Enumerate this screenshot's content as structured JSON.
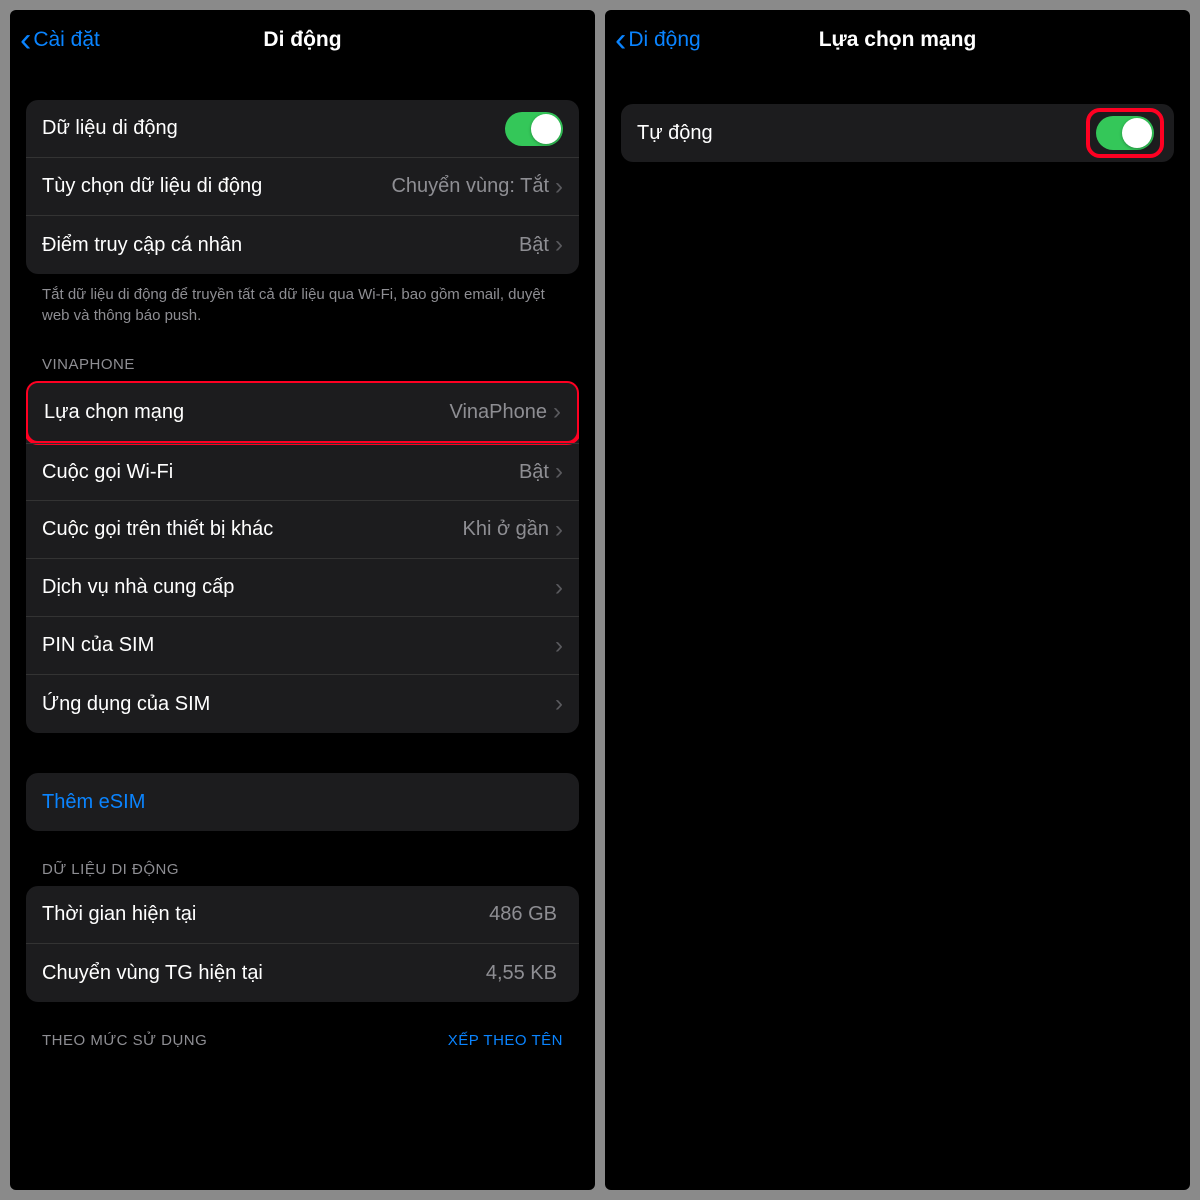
{
  "left": {
    "back": "Cài đặt",
    "title": "Di động",
    "g1": {
      "cellular_data": "Dữ liệu di động",
      "options_label": "Tùy chọn dữ liệu di động",
      "options_value": "Chuyển vùng: Tắt",
      "hotspot_label": "Điểm truy cập cá nhân",
      "hotspot_value": "Bật"
    },
    "footer1": "Tắt dữ liệu di động để truyền tất cả dữ liệu qua Wi-Fi, bao gồm email, duyệt web và thông báo push.",
    "carrier_header": "VINAPHONE",
    "g2": {
      "network_sel_label": "Lựa chọn mạng",
      "network_sel_value": "VinaPhone",
      "wifi_call_label": "Cuộc gọi Wi-Fi",
      "wifi_call_value": "Bật",
      "other_dev_label": "Cuộc gọi trên thiết bị khác",
      "other_dev_value": "Khi ở gần",
      "carrier_svc": "Dịch vụ nhà cung cấp",
      "sim_pin": "PIN của SIM",
      "sim_app": "Ứng dụng của SIM"
    },
    "add_esim": "Thêm eSIM",
    "data_header": "DỮ LIỆU DI ĐỘNG",
    "g4": {
      "period_label": "Thời gian hiện tại",
      "period_value": "486 GB",
      "roam_label": "Chuyển vùng TG hiện tại",
      "roam_value": "4,55 KB"
    },
    "usage_header": "THEO MỨC SỬ DỤNG",
    "sort": "XẾP THEO TÊN"
  },
  "right": {
    "back": "Di động",
    "title": "Lựa chọn mạng",
    "auto": "Tự động"
  }
}
